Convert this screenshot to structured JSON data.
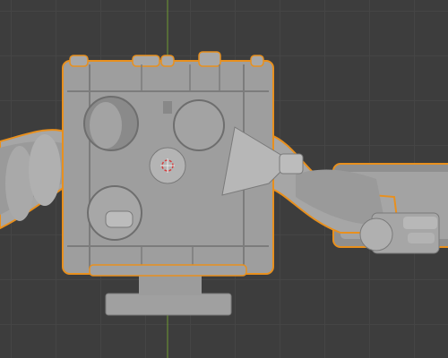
{
  "viewport": {
    "grid_color": "#454545",
    "background_color": "#3d3d3d",
    "y_axis_color": "#7aa13b"
  },
  "scene": {
    "selected_objects": [
      {
        "name_icon": "robot-body-object",
        "outline_color": "#e8901e"
      },
      {
        "name_icon": "robot-left-arm-object",
        "outline_color": "#e8901e"
      },
      {
        "name_icon": "robot-right-arm-object",
        "outline_color": "#e8901e"
      },
      {
        "name_icon": "robot-plate-object",
        "outline_color": "#e8901e"
      }
    ],
    "mesh_color": "#9e9e9e",
    "shadow_color": "#7a7a7a",
    "highlight_color": "#bdbdbd",
    "origin_marker": "3d-cursor-icon"
  }
}
